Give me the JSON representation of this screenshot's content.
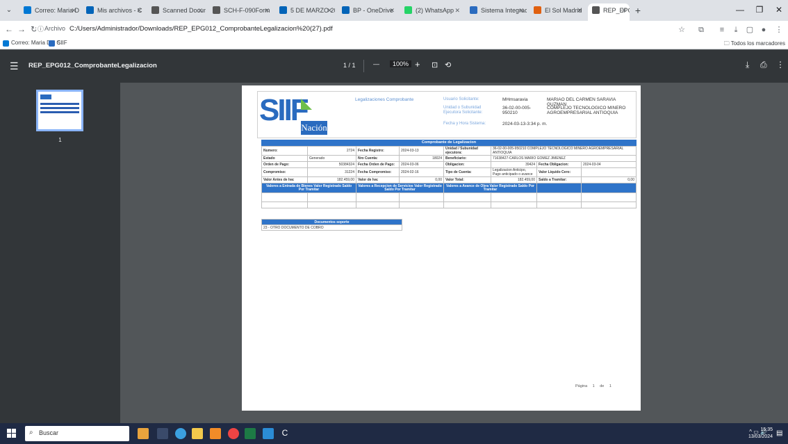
{
  "browser": {
    "tabs": [
      {
        "label": "Correo: Maria De",
        "color": "#0078d4"
      },
      {
        "label": "Mis archivos - C",
        "color": "#0364b8"
      },
      {
        "label": "Scanned Docum",
        "color": "#555555"
      },
      {
        "label": "SCH-F-090Form",
        "color": "#555555"
      },
      {
        "label": "5 DE MARZO 20",
        "color": "#0364b8"
      },
      {
        "label": "BP - OneDrive",
        "color": "#0364b8"
      },
      {
        "label": "(2) WhatsApp",
        "color": "#25d366"
      },
      {
        "label": "Sistema Integrac",
        "color": "#2a6bbf"
      },
      {
        "label": "El Sol Madrid",
        "color": "#e06010"
      },
      {
        "label": "REP_EPG012_Co",
        "color": "#555555",
        "active": true
      }
    ],
    "address": {
      "chip": "Archivo",
      "url": "C:/Users/Administrador/Downloads/REP_EPG012_ComprobanteLegalizacion%20(27).pdf"
    },
    "bookmarks": [
      {
        "label": "Correo: Maria Del C...",
        "color": "#0078d4"
      },
      {
        "label": "SIIF",
        "color": "#2a6bbf"
      }
    ],
    "bookmarks_right": "Todos los marcadores"
  },
  "pdf_toolbar": {
    "title": "REP_EPG012_ComprobanteLegalizacion",
    "page_current": "1",
    "page_total": "1",
    "page_label": "1 / 1",
    "zoom": "100%",
    "thumb_number": "1"
  },
  "report": {
    "logo_text": "SIIF",
    "logo_sub": "Nación",
    "title": "Legalizaciones Comprobante",
    "usuario_label": "Usuario Solicitante:",
    "usuario_id": "MHmsaravia",
    "usuario_nombre": "MARIAO DEL CARMEN SARAVIA GUZMAN",
    "unidad_label": "Unidad o Subunidad Ejecutora Solicitante:",
    "unidad_code": "36-02-00-005-950210",
    "unidad_name": "COMPLEJO TECNOLOGICO MINERO AGROEMPRESARIAL ANTIOQUIA",
    "fecha_label": "Fecha y Hora Sistema:",
    "fecha_val": "2024-03-13-3:34 p. m.",
    "section_title": "Comprobante de Legalizacion",
    "rows": {
      "numero_l": "Numero:",
      "numero_v": "2724",
      "fecha_reg_l": "Fecha Registro:",
      "fecha_reg_v": "2024-03-13",
      "unidad_l": "Unidad / Subunidad ejecutora:",
      "unidad_v": "36-02-00-005-950210 COMPLEJO TECNOLOGICO MINERO AGROEMPRESARIAL ANTIOQUIA",
      "estado_l": "Estado",
      "estado_v": "Generado",
      "nro_cuenta_l": "Nro Cuenta:",
      "nro_cuenta_v": "18024",
      "beneficiario_l": "Beneficiario:",
      "beneficiario_v": "71638427-CARLOS MARIO GOMEZ JIMENEZ",
      "orden_l": "Orden de Pago:",
      "orden_v": "50384324",
      "fecha_orden_l": "Fecha Orden de Pago:",
      "fecha_orden_v": "2024-03-06",
      "obligacion_l": "Obligacion:",
      "obligacion_v": "39424",
      "fecha_oblig_l": "Fecha Obligacion:",
      "fecha_oblig_v": "2024-03-04",
      "compromiso_l": "Compromiso:",
      "compromiso_v": "31224",
      "fecha_comp_l": "Fecha Compromiso:",
      "fecha_comp_v": "2024-02-16",
      "tipo_cuenta_l": "Tipo de Cuenta:",
      "tipo_cuenta_v": "Legalizacion Anticipo, Pago anticipado o avance",
      "valor_liq_l": "Valor Liquido Cero:",
      "valor_liq_v": "",
      "valor_antes_l": "Valor Antes de Iva:",
      "valor_antes_v": "182.459,00",
      "valor_iva_l": "Valor de Iva:",
      "valor_iva_v": "0,00",
      "valor_total_l": "Valor Total:",
      "valor_total_v": "182.459,00",
      "saldo_l": "Saldo a Tramitar:",
      "saldo_v": "0,00"
    },
    "sub_headers": [
      "Valores a Entrada de Bienes Valor Registrado Saldo Por Tramitar",
      "Valores a Recepcion de Servicios Valor Registrado Saldo Por Tramitar",
      "Valores a Avance de Obra Valor Registrado Saldo Por Tramitar"
    ],
    "docs_title": "Documentos soporte",
    "docs_item": "23 - OTRO DOCUMENTO DE COBRO",
    "pagina": "Página 1 de 1"
  },
  "taskbar": {
    "search_placeholder": "Buscar",
    "time": "15:35",
    "date": "13/03/2024"
  }
}
